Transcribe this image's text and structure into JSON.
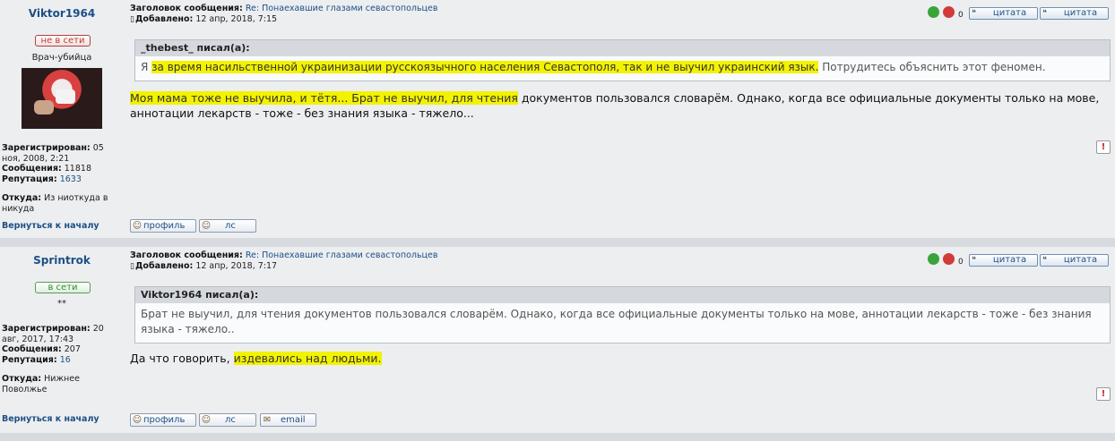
{
  "posts": [
    {
      "username": "Viktor1964",
      "status": "не в сети",
      "rank": "Врач-убийца",
      "registered_label": "Зарегистрирован:",
      "registered": "05 ноя, 2008, 2:21",
      "messages_label": "Сообщения:",
      "messages": "11818",
      "reputation_label": "Репутация:",
      "reputation": "1633",
      "from_label": "Откуда:",
      "from": "Из ниоткуда в никуда",
      "back_to_top": "Вернуться к началу",
      "subject_label": "Заголовок сообщения:",
      "subject": "Re: Понаехавшие глазами севастопольцев",
      "added_label": "Добавлено:",
      "added": "12 апр, 2018, 7:15",
      "rep_count": "0",
      "quote_label": "цитата",
      "quote_label2": "цитата",
      "quote_author": "_thebest_ писал(а):",
      "quote_pre": "Я ",
      "quote_hl": "за время насильственной украинизации русскоязычного населения Севастополя, так и не выучил украинский язык.",
      "quote_post": " Потрудитесь объяснить этот феномен.",
      "msg_hl": "Моя мама тоже не выучила, и тётя... Брат не выучил, для чтения",
      "msg_rest": " документов пользовался словарём. Однако, когда все официальные документы только на мове, аннотации лекарств - тоже - без знания языка - тяжело...",
      "btn_profile": "профиль",
      "btn_pm": "лс"
    },
    {
      "username": "Sprintrok",
      "status": "в сети",
      "rank": "**",
      "registered_label": "Зарегистрирован:",
      "registered": "20 авг, 2017, 17:43",
      "messages_label": "Сообщения:",
      "messages": "207",
      "reputation_label": "Репутация:",
      "reputation": "16",
      "from_label": "Откуда:",
      "from": "Нижнее Поволжье",
      "back_to_top": "Вернуться к началу",
      "subject_label": "Заголовок сообщения:",
      "subject": "Re: Понаехавшие глазами севастопольцев",
      "added_label": "Добавлено:",
      "added": "12 апр, 2018, 7:17",
      "rep_count": "0",
      "quote_label": "цитата",
      "quote_label2": "цитата",
      "quote_author": "Viktor1964 писал(а):",
      "quote_text": "Брат не выучил, для чтения документов пользовался словарём. Однако, когда все официальные документы только на мове, аннотации лекарств - тоже - без знания языка - тяжело..",
      "msg_pre": "Да что говорить, ",
      "msg_hl": "издевались над людьми.",
      "btn_profile": "профиль",
      "btn_pm": "лс",
      "btn_email": "email"
    }
  ],
  "icons": {
    "rep_plus": "green-plus-icon",
    "rep_minus": "red-minus-icon",
    "report": "exclamation-icon",
    "quote": "quote-icon",
    "profile": "profile-icon",
    "pm": "users-icon",
    "email": "envelope-icon"
  }
}
